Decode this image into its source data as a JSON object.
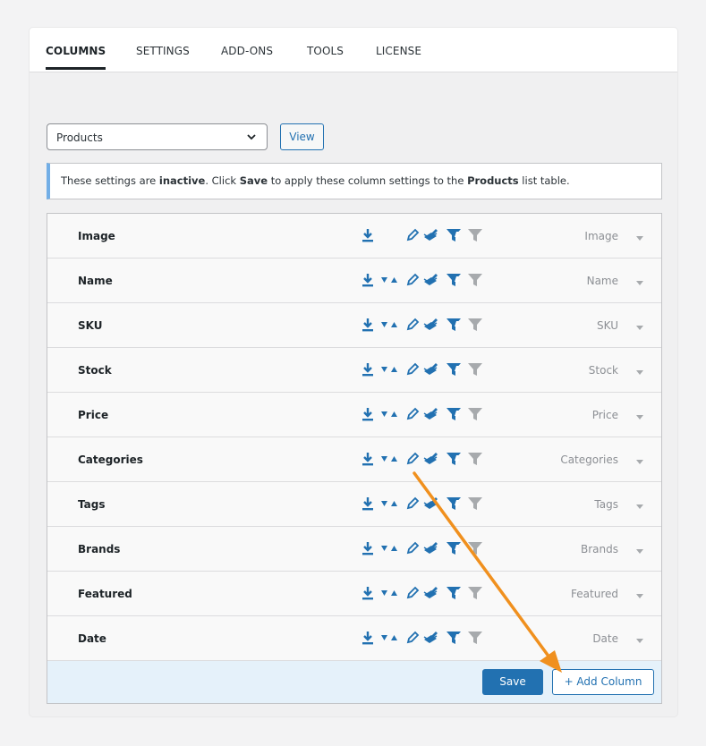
{
  "tabs": [
    {
      "label": "COLUMNS"
    },
    {
      "label": "SETTINGS"
    },
    {
      "label": "ADD-ONS"
    },
    {
      "label": "TOOLS"
    },
    {
      "label": "LICENSE"
    }
  ],
  "list_screen": {
    "selected": "Products",
    "view_label": "View"
  },
  "notice": {
    "t1": "These settings are ",
    "b1": "inactive",
    "t2": ". Click ",
    "b2": "Save",
    "t3": " to apply these column settings to the ",
    "b3": "Products",
    "t4": " list table."
  },
  "columns": [
    {
      "label": "Image",
      "type": "Image"
    },
    {
      "label": "Name",
      "type": "Name"
    },
    {
      "label": "SKU",
      "type": "SKU"
    },
    {
      "label": "Stock",
      "type": "Stock"
    },
    {
      "label": "Price",
      "type": "Price"
    },
    {
      "label": "Categories",
      "type": "Categories"
    },
    {
      "label": "Tags",
      "type": "Tags"
    },
    {
      "label": "Brands",
      "type": "Brands"
    },
    {
      "label": "Featured",
      "type": "Featured"
    },
    {
      "label": "Date",
      "type": "Date"
    }
  ],
  "feature_icons": [
    "export-icon",
    "sort-icon",
    "edit-icon",
    "bulk-edit-icon",
    "smart-filter-icon",
    "filter-icon"
  ],
  "footer": {
    "save_label": "Save",
    "add_label": "+ Add Column"
  },
  "colors": {
    "accent": "#2271b1",
    "arrow": "#f0901e",
    "filter_inactive": "#a7aaad"
  }
}
